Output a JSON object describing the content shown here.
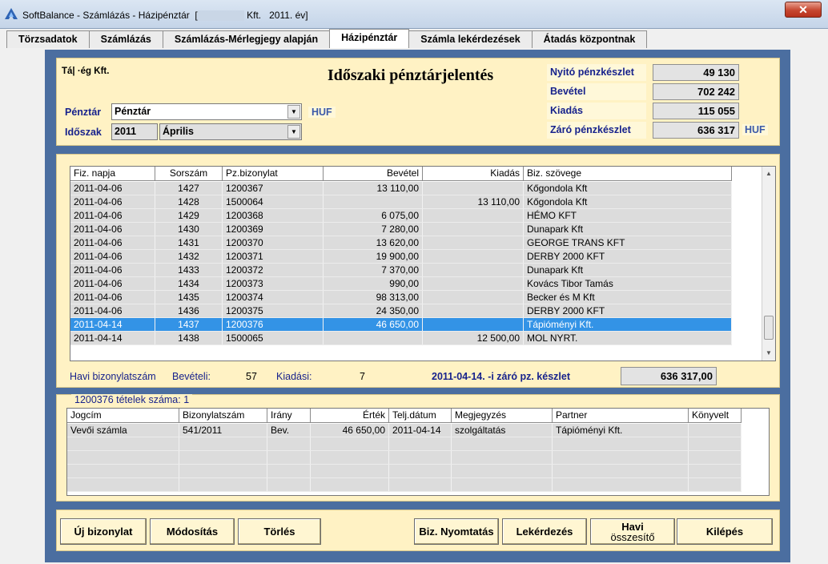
{
  "window": {
    "title_prefix": "SoftBalance - Számlázás - Házipénztár  [",
    "title_suffix": " Kft.   2011. év]",
    "close_label": "✕"
  },
  "tabs": [
    {
      "label": "Törzsadatok"
    },
    {
      "label": "Számlázás"
    },
    {
      "label": "Számlázás-Mérlegjegy alapján"
    },
    {
      "label": "Házipénztár"
    },
    {
      "label": "Számla lekérdezések"
    },
    {
      "label": "Átadás központnak"
    }
  ],
  "header": {
    "company": "Tá|         ·ég Kft.",
    "report_title": "Időszaki pénztárjelentés",
    "penztar_label": "Pénztár",
    "penztar_value": "Pénztár",
    "currency": "HUF",
    "idoszak_label": "Időszak",
    "year": "2011",
    "month": "Április"
  },
  "summary": {
    "nyito_label": "Nyitó pénzkészlet",
    "nyito_value": "49 130",
    "bevetel_label": "Bevétel",
    "bevetel_value": "702 242",
    "kiadas_label": "Kiadás",
    "kiadas_value": "115 055",
    "zaro_label": "Záró pénzkészlet",
    "zaro_value": "636 317",
    "currency": "HUF"
  },
  "main_grid": {
    "columns": [
      "Fiz. napja",
      "Sorszám",
      "Pz.bizonylat",
      "Bevétel",
      "Kiadás",
      "Biz. szövege"
    ],
    "rows": [
      [
        "2011-04-06",
        "1427",
        "1200367",
        "13 110,00",
        "",
        "Kőgondola Kft"
      ],
      [
        "2011-04-06",
        "1428",
        "1500064",
        "",
        "13 110,00",
        "Kőgondola Kft"
      ],
      [
        "2011-04-06",
        "1429",
        "1200368",
        "6 075,00",
        "",
        "HÉMO KFT"
      ],
      [
        "2011-04-06",
        "1430",
        "1200369",
        "7 280,00",
        "",
        "Dunapark Kft"
      ],
      [
        "2011-04-06",
        "1431",
        "1200370",
        "13 620,00",
        "",
        "GEORGE TRANS KFT"
      ],
      [
        "2011-04-06",
        "1432",
        "1200371",
        "19 900,00",
        "",
        "DERBY 2000 KFT"
      ],
      [
        "2011-04-06",
        "1433",
        "1200372",
        "7 370,00",
        "",
        "Dunapark Kft"
      ],
      [
        "2011-04-06",
        "1434",
        "1200373",
        "990,00",
        "",
        "Kovács Tibor Tamás"
      ],
      [
        "2011-04-06",
        "1435",
        "1200374",
        "98 313,00",
        "",
        "Becker és M Kft"
      ],
      [
        "2011-04-06",
        "1436",
        "1200375",
        "24 350,00",
        "",
        "DERBY 2000 KFT"
      ],
      [
        "2011-04-14",
        "1437",
        "1200376",
        "46 650,00",
        "",
        "Tápióményi Kft."
      ],
      [
        "2011-04-14",
        "1438",
        "1500065",
        "",
        "12 500,00",
        "MOL NYRT."
      ]
    ],
    "selected_index": 10
  },
  "footer": {
    "havi_label": "Havi bizonylatszám",
    "beveteli_label": "Bevételi:",
    "beveteli_value": "57",
    "kiadasi_label": "Kiadási:",
    "kiadasi_value": "7",
    "closing_label": "2011-04-14. -i záró pz. készlet",
    "closing_value": "636 317,00"
  },
  "detail": {
    "caption": "1200376   tételek száma: 1",
    "columns": [
      "Jogcím",
      "Bizonylatszám",
      "Irány",
      "Érték",
      "Telj.dátum",
      "Megjegyzés",
      "Partner",
      "Könyvelt"
    ],
    "rows": [
      [
        "Vevői számla",
        "541/2011",
        "Bev.",
        "46 650,00",
        "2011-04-14",
        "szolgáltatás",
        "Tápióményi Kft.",
        ""
      ]
    ]
  },
  "buttons": {
    "new": "Új bizonylat",
    "modify": "Módosítás",
    "delete": "Törlés",
    "print": "Biz. Nyomtatás",
    "query": "Lekérdezés",
    "monthly_1": "Havi",
    "monthly_2": "összesítő",
    "exit": "Kilépés"
  }
}
